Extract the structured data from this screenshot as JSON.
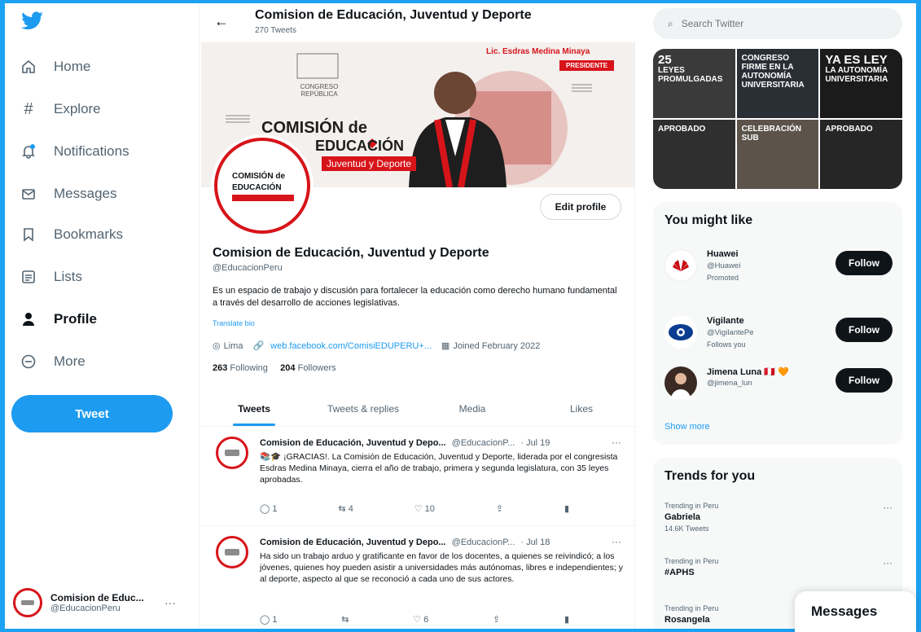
{
  "colors": {
    "accent": "#1d9bf0",
    "brand_red": "#d7141a",
    "frame": "#1da1f2"
  },
  "sidebar": {
    "logo_icon": "twitter-bird-icon",
    "items": [
      {
        "label": "Home",
        "icon": "home-icon"
      },
      {
        "label": "Explore",
        "icon": "hashtag-icon"
      },
      {
        "label": "Notifications",
        "icon": "bell-icon"
      },
      {
        "label": "Messages",
        "icon": "envelope-icon"
      },
      {
        "label": "Bookmarks",
        "icon": "bookmark-icon"
      },
      {
        "label": "Lists",
        "icon": "list-icon"
      },
      {
        "label": "Profile",
        "icon": "person-icon"
      },
      {
        "label": "More",
        "icon": "more-circle-icon"
      }
    ],
    "tweet_button": "Tweet",
    "account": {
      "name": "Comision de Educ...",
      "handle": "@EducacionPeru",
      "menu": "···"
    }
  },
  "header": {
    "back": "←",
    "title": "Comision de Educación, Juventud y Deporte",
    "tweet_count": "270 Tweets"
  },
  "banner": {
    "presenter_name": "Lic. Esdras Medina Minaya",
    "presenter_role": "PRESIDENTE",
    "congreso": "CONGRESO REPÚBLICA",
    "line1": "COMISIÓN de",
    "line2": "EDUCACIÓN",
    "line3": "Juventud y Deporte"
  },
  "avatar_text": {
    "t1": "COMISIÓN de",
    "t2": "EDUCACIÓN"
  },
  "profile": {
    "edit_button": "Edit profile",
    "name": "Comision de Educación, Juventud y Deporte",
    "handle": "@EducacionPeru",
    "bio": "Es un espacio de trabajo y discusión para fortalecer la educación como derecho humano fundamental a través del desarrollo de acciones legislativas.",
    "translate": "Translate bio",
    "location": "Lima",
    "link": "web.facebook.com/ComisiEDUPERU+...",
    "joined": "Joined February 2022",
    "following_count": "263",
    "following_label": "Following",
    "followers_count": "204",
    "followers_label": "Followers"
  },
  "tabs": [
    "Tweets",
    "Tweets & replies",
    "Media",
    "Likes"
  ],
  "tweets": [
    {
      "name": "Comision de Educación, Juventud y Depo...",
      "handle": "@EducacionP...",
      "date": "· Jul 19",
      "text": "📚🎓 ¡GRACIAS!. La Comisión de Educación, Juventud y Deporte, liderada por el congresista Esdras Medina Minaya, cierra el año de trabajo, primera y segunda legislatura, con 35 leyes aprobadas.",
      "replies": "1",
      "retweets": "4",
      "likes": "10"
    },
    {
      "name": "Comision de Educación, Juventud y Depo...",
      "handle": "@EducacionP...",
      "date": "· Jul 18",
      "text": "Ha sido un trabajo arduo y gratificante en favor de los docentes, a quienes se reivindicó; a los jóvenes, quienes hoy pueden asistir a universidades más autónomas, libres e independientes; y al deporte, aspecto al que se reconoció a cada uno de sus actores.",
      "replies": "1",
      "retweets": "",
      "likes": "6"
    }
  ],
  "search": {
    "placeholder": "Search Twitter"
  },
  "media": [
    {
      "big": "25",
      "small": "LEYES PROMULGADAS"
    },
    {
      "big": "",
      "small": "CONGRESO FIRME EN LA AUTONOMÍA UNIVERSITARIA"
    },
    {
      "big": "YA ES LEY",
      "small": "LA AUTONOMÍA UNIVERSITARIA"
    },
    {
      "big": "",
      "small": "APROBADO"
    },
    {
      "big": "",
      "small": "CELEBRACIÓN SUB"
    },
    {
      "big": "",
      "small": "APROBADO"
    }
  ],
  "might_like": {
    "title": "You might like",
    "items": [
      {
        "name": "Huawei",
        "handle": "@Huawei",
        "promoted": "Promoted",
        "follow": "Follow"
      },
      {
        "name": "Vigilante",
        "handle": "@VigilantePe",
        "promoted": "Follows you",
        "follow": "Follow"
      },
      {
        "name": "Jimena Luna 🇵🇪 🧡",
        "handle": "@jimena_lun",
        "promoted": "",
        "follow": "Follow"
      }
    ],
    "show_more": "Show more"
  },
  "trends": {
    "title": "Trends for you",
    "items": [
      {
        "context": "Trending in Peru",
        "name": "Gabriela",
        "count": "14.6K Tweets"
      },
      {
        "context": "Trending in Peru",
        "name": "#APHS",
        "count": ""
      },
      {
        "context": "Trending in Peru",
        "name": "Rosangela",
        "count": ""
      }
    ]
  },
  "messages_dock": "Messages"
}
